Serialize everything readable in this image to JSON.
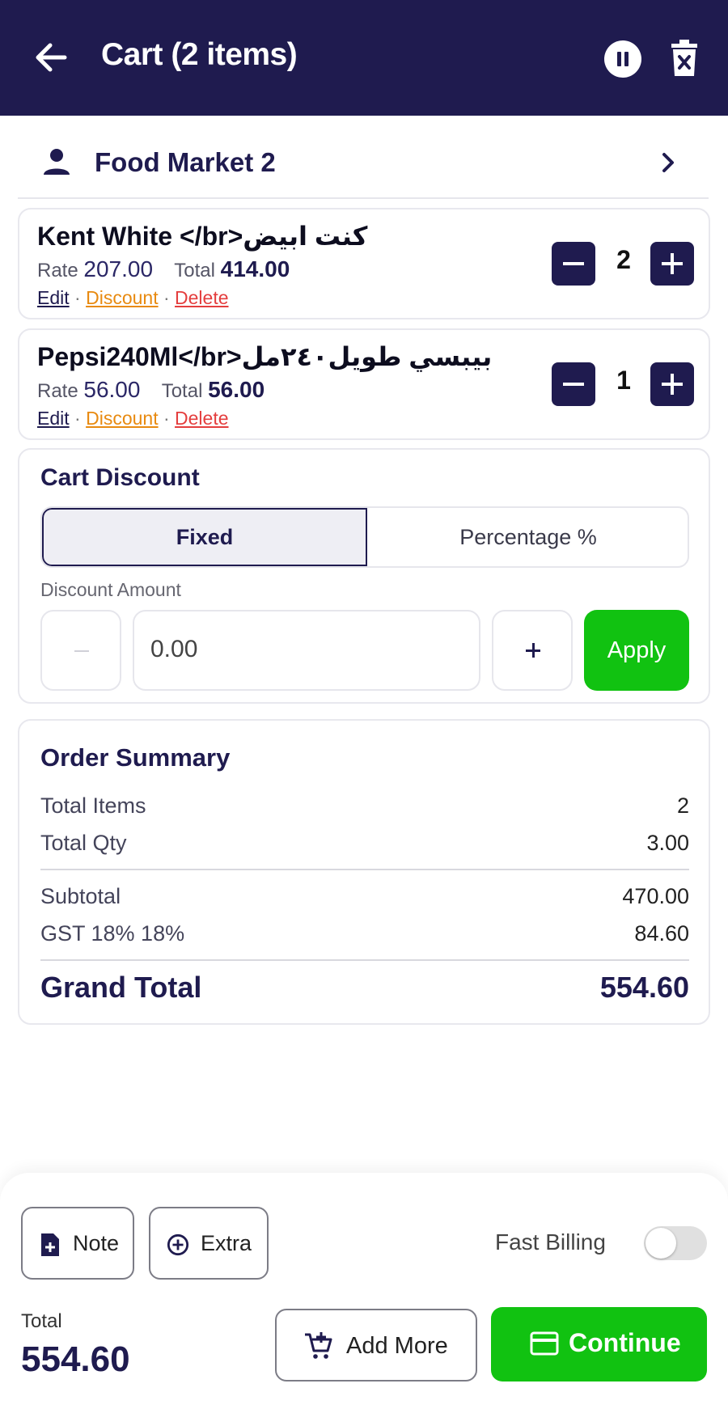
{
  "header": {
    "title": "Cart (2 items)"
  },
  "customer": {
    "name": "Food Market 2"
  },
  "items": [
    {
      "name": "Kent White </br>كنت ابيض",
      "rate_label": "Rate",
      "rate": "207.00",
      "total_label": "Total",
      "total": "414.00",
      "edit": "Edit",
      "discount": "Discount",
      "delete": "Delete",
      "qty": "2"
    },
    {
      "name": "Pepsi240Ml</br>بيبسي طويل٢٤٠مل",
      "rate_label": "Rate",
      "rate": "56.00",
      "total_label": "Total",
      "total": "56.00",
      "edit": "Edit",
      "discount": "Discount",
      "delete": "Delete",
      "qty": "1"
    }
  ],
  "cart_discount": {
    "title": "Cart Discount",
    "options": [
      "Fixed",
      "Percentage %"
    ],
    "selected": "Fixed",
    "amount_label": "Discount Amount",
    "decrement": "−",
    "amount": "0.00",
    "increment": "+",
    "apply": "Apply"
  },
  "summary": {
    "title": "Order Summary",
    "total_items_label": "Total Items",
    "total_items": "2",
    "total_qty_label": "Total Qty",
    "total_qty": "3.00",
    "subtotal_label": "Subtotal",
    "subtotal": "470.00",
    "gst_label": "GST 18% 18%",
    "gst": "84.60",
    "grand_label": "Grand Total",
    "grand": "554.60"
  },
  "bottom": {
    "note": "Note",
    "extra": "Extra",
    "fast_billing": "Fast Billing",
    "fast_billing_on": false,
    "total_label": "Total",
    "total": "554.60",
    "add_more": "Add More",
    "continue": "Continue"
  },
  "colors": {
    "primary": "#1f1b4f",
    "accent_green": "#11c211",
    "discount_orange": "#e88a10",
    "delete_red": "#e43e3e"
  }
}
